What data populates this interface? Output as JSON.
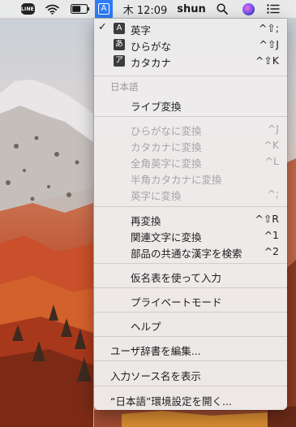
{
  "menubar": {
    "line_icon_text": "LINE",
    "input_indicator": "A",
    "clock": "木 12:09",
    "user": "shun"
  },
  "menu": {
    "modes": [
      {
        "kbd": "A",
        "label": "英字",
        "shortcut": "^⇧;",
        "checked": true
      },
      {
        "kbd": "あ",
        "label": "ひらがな",
        "shortcut": "^⇧J",
        "checked": false
      },
      {
        "kbd": "ア",
        "label": "カタカナ",
        "shortcut": "^⇧K",
        "checked": false
      }
    ],
    "section_japanese": "日本語",
    "live_conversion": "ライブ変換",
    "convert_items": [
      {
        "label": "ひらがなに変換",
        "shortcut": "^J"
      },
      {
        "label": "カタカナに変換",
        "shortcut": "^K"
      },
      {
        "label": "全角英字に変換",
        "shortcut": "^L"
      },
      {
        "label": "半角カタカナに変換",
        "shortcut": ""
      },
      {
        "label": "英字に変換",
        "shortcut": "^;"
      }
    ],
    "reconvert_items": [
      {
        "label": "再変換",
        "shortcut": "^⇧R"
      },
      {
        "label": "関連文字に変換",
        "shortcut": "^1"
      },
      {
        "label": "部品の共通な漢字を検索",
        "shortcut": "^2"
      }
    ],
    "kana_table": "仮名表を使って入力",
    "private_mode": "プライベートモード",
    "help": "ヘルプ",
    "edit_dictionary": "ユーザ辞書を編集...",
    "show_source_name": "入力ソース名を表示",
    "open_preferences": "“日本語”環境設定を開く..."
  },
  "colors": {
    "menubar_highlight": "#2e7cf6",
    "disabled_text": "#a5a3a5"
  }
}
